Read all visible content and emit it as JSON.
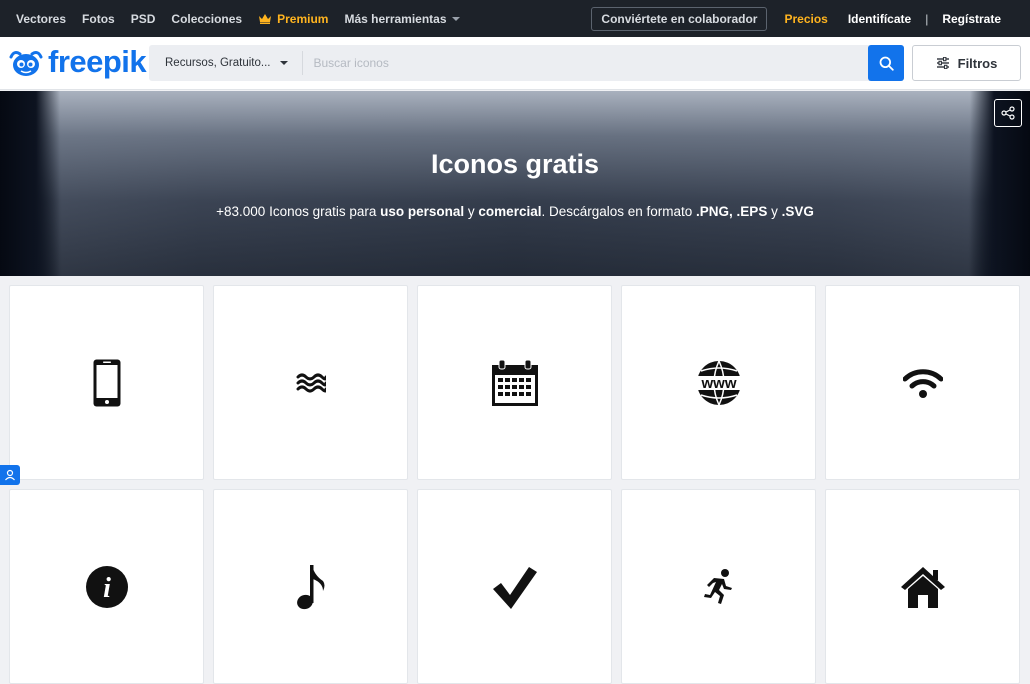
{
  "topnav": {
    "items": [
      "Vectores",
      "Fotos",
      "PSD",
      "Colecciones"
    ],
    "premium": "Premium",
    "more_tools": "Más herramientas",
    "collab_button": "Conviértete en colaborador",
    "pricing": "Precios",
    "login": "Identifícate",
    "separator": "|",
    "register": "Regístrate"
  },
  "header": {
    "logo": "freepik",
    "resource_select": "Recursos, Gratuito...",
    "search_placeholder": "Buscar iconos",
    "filters_label": "Filtros"
  },
  "hero": {
    "title": "Iconos gratis",
    "subtitle_parts": {
      "p1": "+83.000 Iconos gratis para ",
      "b1": "uso personal",
      "p2": " y ",
      "b2": "comercial",
      "p3": ". Descárgalos en formato ",
      "b3": ".PNG, .EPS",
      "p4": " y ",
      "b4": ".SVG"
    }
  },
  "icons": [
    {
      "name": "smartphone-icon"
    },
    {
      "name": "waves-icon"
    },
    {
      "name": "calendar-icon"
    },
    {
      "name": "www-globe-icon",
      "text": "www"
    },
    {
      "name": "wifi-icon"
    },
    {
      "name": "info-icon",
      "text": "i"
    },
    {
      "name": "music-note-icon"
    },
    {
      "name": "checkmark-icon"
    },
    {
      "name": "running-man-icon"
    },
    {
      "name": "home-icon"
    }
  ],
  "colors": {
    "topbar": "#1d2229",
    "brand": "#1273eb",
    "premium": "#ffb41f"
  }
}
